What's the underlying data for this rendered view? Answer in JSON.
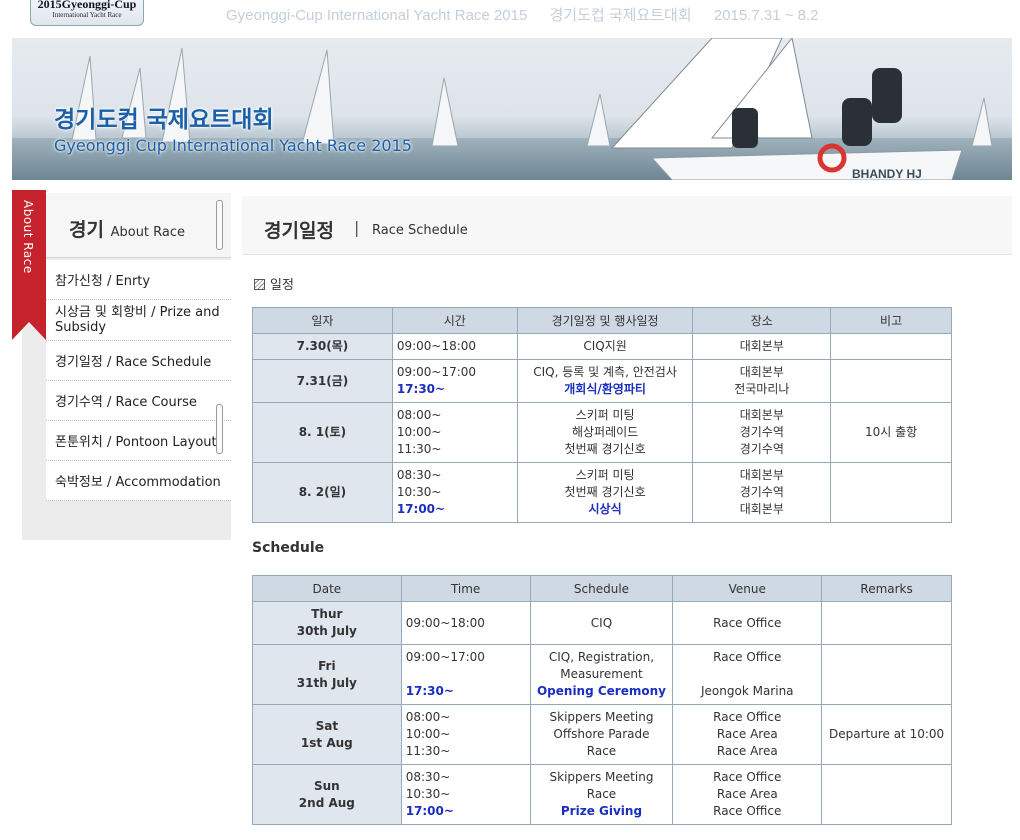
{
  "top": {
    "logo_line1": "2015Gyeonggi-Cup",
    "logo_line2": "International Yacht Race",
    "title_en": "Gyeonggi-Cup International Yacht Race 2015",
    "title_kr": "경기도컵 국제요트대회",
    "dates": "2015.7.31 ~ 8.2"
  },
  "banner": {
    "title_kr": "경기도컵 국제요트대회",
    "title_en": "Gyeonggi Cup International Yacht Race 2015",
    "boat_label": "BHANDY HJ"
  },
  "sidebar": {
    "tab": "About Race",
    "heading_kr": "경기",
    "heading_en": "About Race",
    "items": [
      {
        "label": "참가신청 / Enrty"
      },
      {
        "label": "시상금 및 회항비 / Prize and Subsidy"
      },
      {
        "label": "경기일정 / Race Schedule"
      },
      {
        "label": "경기수역 / Race Course"
      },
      {
        "label": "폰툰위치 / Pontoon Layout"
      },
      {
        "label": "숙박정보 / Accommodation"
      }
    ]
  },
  "main": {
    "title": "경기일정",
    "separator": "|",
    "subtitle": "Race Schedule",
    "section_kr": "일정",
    "section_en": "Schedule"
  },
  "kr_table": {
    "headers": [
      "일자",
      "시간",
      "경기일정 및 행사일정",
      "장소",
      "비고"
    ],
    "rows": [
      {
        "date": "7.30(목)",
        "time": [
          "09:00~18:00"
        ],
        "event": [
          "CIQ지원"
        ],
        "venue": [
          "대회본부"
        ],
        "note": ""
      },
      {
        "date": "7.31(금)",
        "time": [
          "09:00~17:00",
          "17:30~"
        ],
        "event": [
          "CIQ, 등록 및 계측, 안전검사",
          "개회식/환영파티"
        ],
        "venue": [
          "대회본부",
          "전국마리나"
        ],
        "note": ""
      },
      {
        "date": "8. 1(토)",
        "time": [
          "08:00~",
          "10:00~",
          "11:30~"
        ],
        "event": [
          "스키퍼 미팅",
          "해상퍼레이드",
          "첫번째 경기신호"
        ],
        "venue": [
          "대회본부",
          "경기수역",
          "경기수역"
        ],
        "note": "10시 출항"
      },
      {
        "date": "8. 2(일)",
        "time": [
          "08:30~",
          "10:30~",
          "17:00~"
        ],
        "event": [
          "스키퍼 미팅",
          "첫번째 경기신호",
          "시상식"
        ],
        "venue": [
          "대회본부",
          "경기수역",
          "대회본부"
        ],
        "note": ""
      }
    ]
  },
  "en_table": {
    "headers": [
      "Date",
      "Time",
      "Schedule",
      "Venue",
      "Remarks"
    ],
    "rows": [
      {
        "date": [
          "Thur",
          "30th July"
        ],
        "time": [
          "09:00~18:00"
        ],
        "event": [
          "CIQ"
        ],
        "venue": [
          "Race Office"
        ],
        "note": ""
      },
      {
        "date": [
          "Fri",
          "31th July"
        ],
        "time": [
          "09:00~17:00",
          "17:30~"
        ],
        "event": [
          "CIQ, Registration,",
          "Measurement",
          "Opening Ceremony"
        ],
        "venue": [
          "Race Office",
          "Jeongok Marina"
        ],
        "note": ""
      },
      {
        "date": [
          "Sat",
          "1st Aug"
        ],
        "time": [
          "08:00~",
          "10:00~",
          "11:30~"
        ],
        "event": [
          "Skippers Meeting",
          "Offshore Parade",
          "Race"
        ],
        "venue": [
          "Race Office",
          "Race Area",
          "Race Area"
        ],
        "note": "Departure at 10:00"
      },
      {
        "date": [
          "Sun",
          "2nd Aug"
        ],
        "time": [
          "08:30~",
          "10:30~",
          "17:00~"
        ],
        "event": [
          "Skippers Meeting",
          "Race",
          "Prize Giving"
        ],
        "venue": [
          "Race Office",
          "Race Area",
          "Race Office"
        ],
        "note": ""
      }
    ]
  }
}
